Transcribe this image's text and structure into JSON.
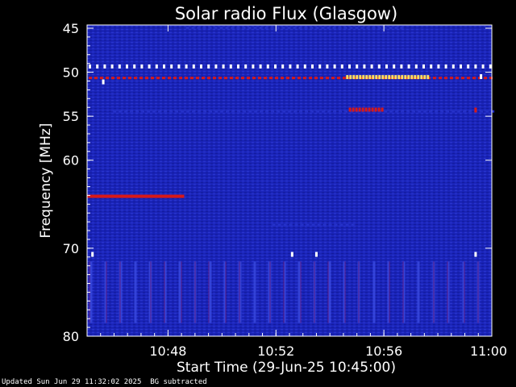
{
  "chart_data": {
    "type": "heatmap",
    "title": "Solar radio Flux (Glasgow)",
    "ylabel": "Frequency [MHz]",
    "xlabel": "Start Time (29-Jun-25 10:45:00)",
    "x_range_minutes": [
      0,
      15
    ],
    "ylim": [
      45,
      80
    ],
    "y_ticks": [
      45,
      50,
      55,
      60,
      70,
      80
    ],
    "y_tick_labels": [
      "45",
      "50",
      "55",
      "60",
      "70",
      "80"
    ],
    "x_ticks": [
      3,
      7,
      11,
      15
    ],
    "x_tick_labels": [
      "10:48",
      "10:52",
      "10:56",
      "11:00"
    ],
    "colors": {
      "background": "#1a24b8",
      "low": "#2430c8",
      "mid": "#d81818",
      "high": "#ffffff",
      "highlight": "#ffe060"
    },
    "features": [
      {
        "kind": "band",
        "freq_mhz": 49.3,
        "t_start": 0,
        "t_end": 15,
        "intensity": "high",
        "pattern": "dotted"
      },
      {
        "kind": "band",
        "freq_mhz": 50.7,
        "t_start": 0,
        "t_end": 15,
        "intensity": "mid",
        "pattern": "dotted"
      },
      {
        "kind": "band",
        "freq_mhz": 54.5,
        "t_start": 0.9,
        "t_end": 15,
        "intensity": "low",
        "pattern": "dotted"
      },
      {
        "kind": "band",
        "freq_mhz": 64.1,
        "t_start": 0,
        "t_end": 3.6,
        "intensity": "mid",
        "pattern": "solid"
      },
      {
        "kind": "band",
        "freq_mhz": 67.4,
        "t_start": 6.8,
        "t_end": 9.9,
        "intensity": "low",
        "pattern": "dotted"
      },
      {
        "kind": "band",
        "freq_mhz": 45.0,
        "t_start": 3.6,
        "t_end": 11.8,
        "intensity": "low",
        "pattern": "dotted"
      },
      {
        "kind": "burst",
        "freq_mhz": 50.6,
        "t_start": 9.6,
        "t_end": 12.6,
        "intensity": "highlight"
      },
      {
        "kind": "burst",
        "freq_mhz": 54.3,
        "t_start": 9.7,
        "t_end": 10.9,
        "intensity": "mid"
      },
      {
        "kind": "spot",
        "freq_mhz": 70.7,
        "t": 0.2,
        "intensity": "high"
      },
      {
        "kind": "spot",
        "freq_mhz": 70.7,
        "t": 7.6,
        "intensity": "high"
      },
      {
        "kind": "spot",
        "freq_mhz": 70.7,
        "t": 8.5,
        "intensity": "high"
      },
      {
        "kind": "spot",
        "freq_mhz": 70.7,
        "t": 14.4,
        "intensity": "high"
      },
      {
        "kind": "spot",
        "freq_mhz": 51.1,
        "t": 0.6,
        "intensity": "high"
      },
      {
        "kind": "spot",
        "freq_mhz": 50.5,
        "t": 14.6,
        "intensity": "high"
      },
      {
        "kind": "spot",
        "freq_mhz": 54.3,
        "t": 14.4,
        "intensity": "mid"
      }
    ]
  },
  "footer": {
    "updated": "Updated Sun Jun 29 11:32:02 2025",
    "note": "BG subtracted"
  }
}
